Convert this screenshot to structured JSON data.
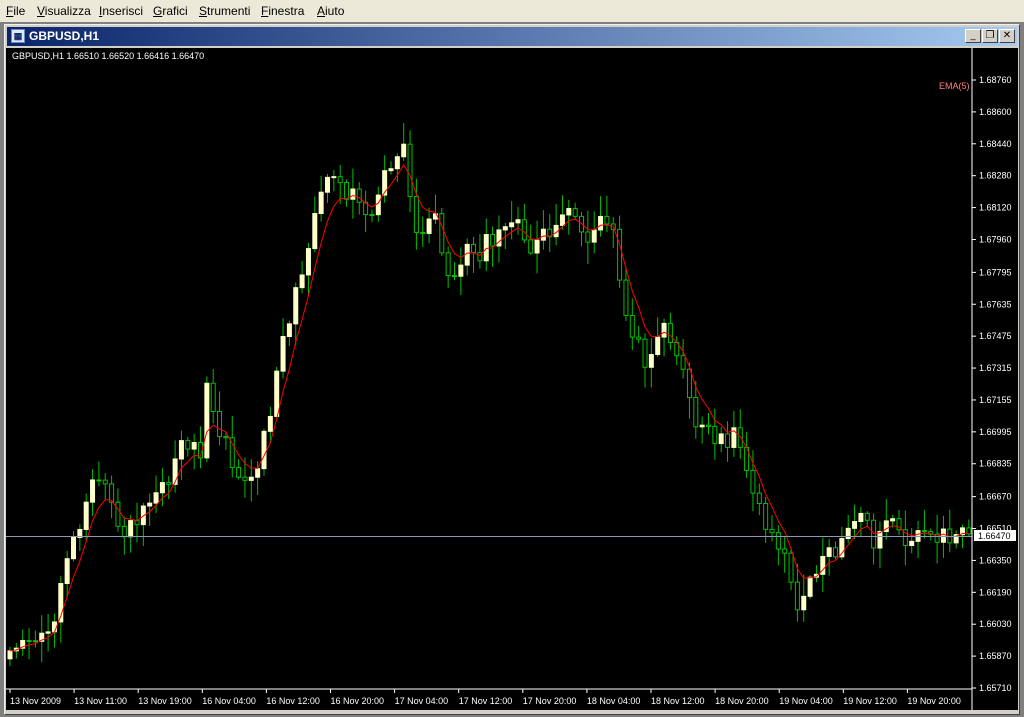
{
  "menu": [
    "File",
    "Visualizza",
    "Inserisci",
    "Grafici",
    "Strumenti",
    "Finestra",
    "Aiuto"
  ],
  "window": {
    "title": "GBPUSD,H1",
    "icon": "chart-window-icon",
    "buttons": {
      "minimize": "_",
      "restore": "❐",
      "close": "✕"
    }
  },
  "chart": {
    "info_line": "GBPUSD,H1  1.66510 1.66520 1.66416 1.66470",
    "indicator_label": "EMA(5)",
    "current_price_label": "1.66470",
    "colors": {
      "background": "#000000",
      "bull_candle": "#ffffc8",
      "wick": "#00c000",
      "ema": "#ff0000",
      "bid_line": "#8c9ab8",
      "axis_text": "#ffffff",
      "indicator_label": "#ff8080"
    }
  },
  "chart_data": {
    "type": "candlestick",
    "symbol": "GBPUSD",
    "timeframe": "H1",
    "y_ticks": [
      "1.68760",
      "1.68600",
      "1.68440",
      "1.68280",
      "1.68120",
      "1.67960",
      "1.67795",
      "1.67635",
      "1.67475",
      "1.67315",
      "1.67155",
      "1.66995",
      "1.66835",
      "1.66670",
      "1.66510",
      "1.66350",
      "1.66190",
      "1.66030",
      "1.65870",
      "1.65710"
    ],
    "x_ticks": [
      "13 Nov 2009",
      "13 Nov 11:00",
      "13 Nov 19:00",
      "16 Nov 04:00",
      "16 Nov 12:00",
      "16 Nov 20:00",
      "17 Nov 04:00",
      "17 Nov 12:00",
      "17 Nov 20:00",
      "18 Nov 04:00",
      "18 Nov 12:00",
      "18 Nov 20:00",
      "19 Nov 04:00",
      "19 Nov 12:00",
      "19 Nov 20:00"
    ],
    "ylim": [
      1.6571,
      1.6876
    ],
    "bid": 1.6647,
    "indicator": "EMA(5)",
    "close_path": [
      [
        0,
        1.6585
      ],
      [
        6,
        1.6598
      ],
      [
        10,
        1.6644
      ],
      [
        13,
        1.667
      ],
      [
        16,
        1.6668
      ],
      [
        18,
        1.6645
      ],
      [
        21,
        1.6663
      ],
      [
        24,
        1.6672
      ],
      [
        27,
        1.6692
      ],
      [
        30,
        1.6691
      ],
      [
        31,
        1.6719
      ],
      [
        34,
        1.6692
      ],
      [
        37,
        1.6672
      ],
      [
        40,
        1.6694
      ],
      [
        42,
        1.6728
      ],
      [
        45,
        1.677
      ],
      [
        48,
        1.681
      ],
      [
        51,
        1.6829
      ],
      [
        54,
        1.6816
      ],
      [
        57,
        1.6808
      ],
      [
        59,
        1.6827
      ],
      [
        62,
        1.6838
      ],
      [
        64,
        1.6798
      ],
      [
        67,
        1.6808
      ],
      [
        69,
        1.6778
      ],
      [
        72,
        1.6794
      ],
      [
        74,
        1.6788
      ],
      [
        77,
        1.6803
      ],
      [
        80,
        1.6805
      ],
      [
        82,
        1.6794
      ],
      [
        85,
        1.68
      ],
      [
        88,
        1.6812
      ],
      [
        90,
        1.6795
      ],
      [
        93,
        1.681
      ],
      [
        95,
        1.6798
      ],
      [
        97,
        1.6762
      ],
      [
        100,
        1.6732
      ],
      [
        103,
        1.6749
      ],
      [
        105,
        1.6738
      ],
      [
        108,
        1.6705
      ],
      [
        111,
        1.6693
      ],
      [
        114,
        1.6698
      ],
      [
        116,
        1.668
      ],
      [
        119,
        1.665
      ],
      [
        122,
        1.6637
      ],
      [
        124,
        1.6615
      ],
      [
        127,
        1.6632
      ],
      [
        130,
        1.6642
      ],
      [
        133,
        1.6658
      ],
      [
        136,
        1.6647
      ],
      [
        138,
        1.6653
      ],
      [
        141,
        1.6647
      ]
    ]
  }
}
